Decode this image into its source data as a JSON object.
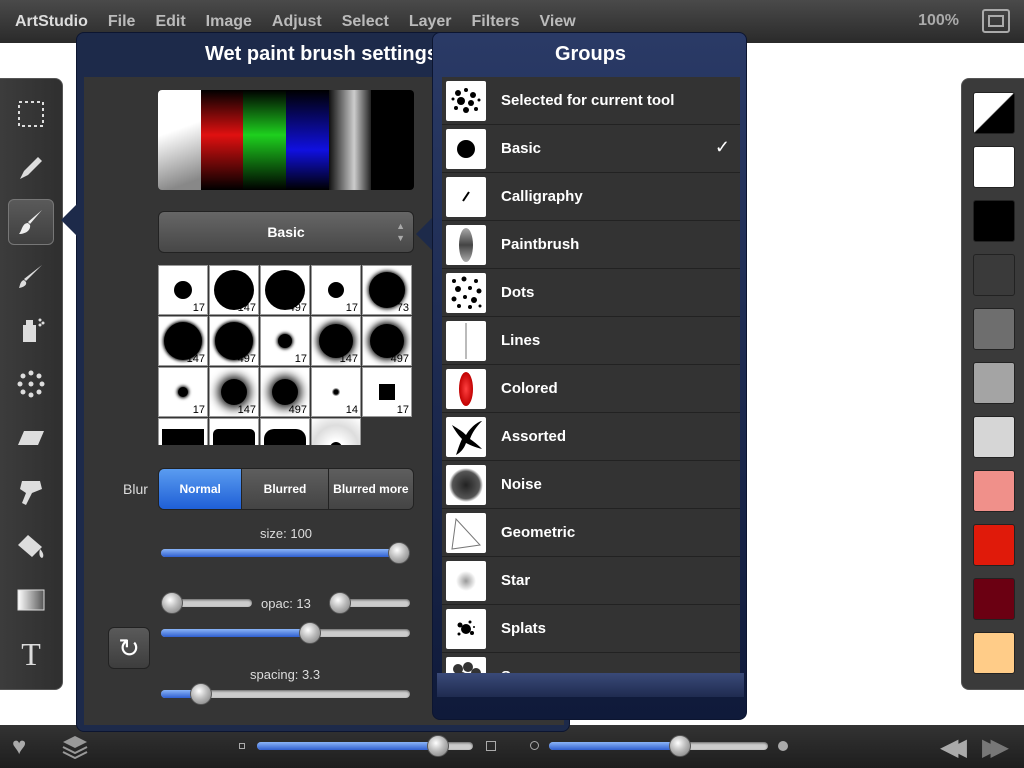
{
  "menubar": {
    "app_name": "ArtStudio",
    "items": [
      "File",
      "Edit",
      "Image",
      "Adjust",
      "Select",
      "Layer",
      "Filters",
      "View"
    ],
    "zoom": "100%"
  },
  "brush_panel": {
    "title": "Wet paint brush settings",
    "selected_group": "Basic",
    "brush_sizes": [
      "17",
      "147",
      "497",
      "17",
      "73",
      "147",
      "497",
      "17",
      "147",
      "497",
      "17",
      "147",
      "497",
      "14",
      "17"
    ],
    "blur_label": "Blur",
    "blur_options": [
      "Normal",
      "Blurred",
      "Blurred more"
    ],
    "blur_selected": "Normal",
    "size_label": "size: 100",
    "size_value": 1.0,
    "opacity_label": "opac: 13",
    "opacity_top_left": 0.0,
    "opacity_top_right": 0.0,
    "opacity_value": 0.6,
    "spacing_label": "spacing: 3.3",
    "spacing_value": 0.16
  },
  "groups_panel": {
    "title": "Groups",
    "items": [
      "Selected for current tool",
      "Basic",
      "Calligraphy",
      "Paintbrush",
      "Dots",
      "Lines",
      "Colored",
      "Assorted",
      "Noise",
      "Geometric",
      "Star",
      "Splats",
      "Sponges"
    ],
    "checked": "Basic",
    "checkmark": "✓"
  },
  "palette": {
    "colors": [
      "#ffffff",
      "#000000",
      "#3a3a3a",
      "#6e6e6e",
      "#a4a4a4",
      "#d6d6d6",
      "#f0908a",
      "#e01a0a",
      "#6b0012",
      "#ffcc88"
    ]
  },
  "bottom_bar": {
    "slider1_value": 0.84,
    "slider2_value": 0.6
  },
  "icons": {
    "heart": "♥",
    "rewind": "◀◀",
    "forward": "▶▶",
    "refresh": "↻"
  }
}
